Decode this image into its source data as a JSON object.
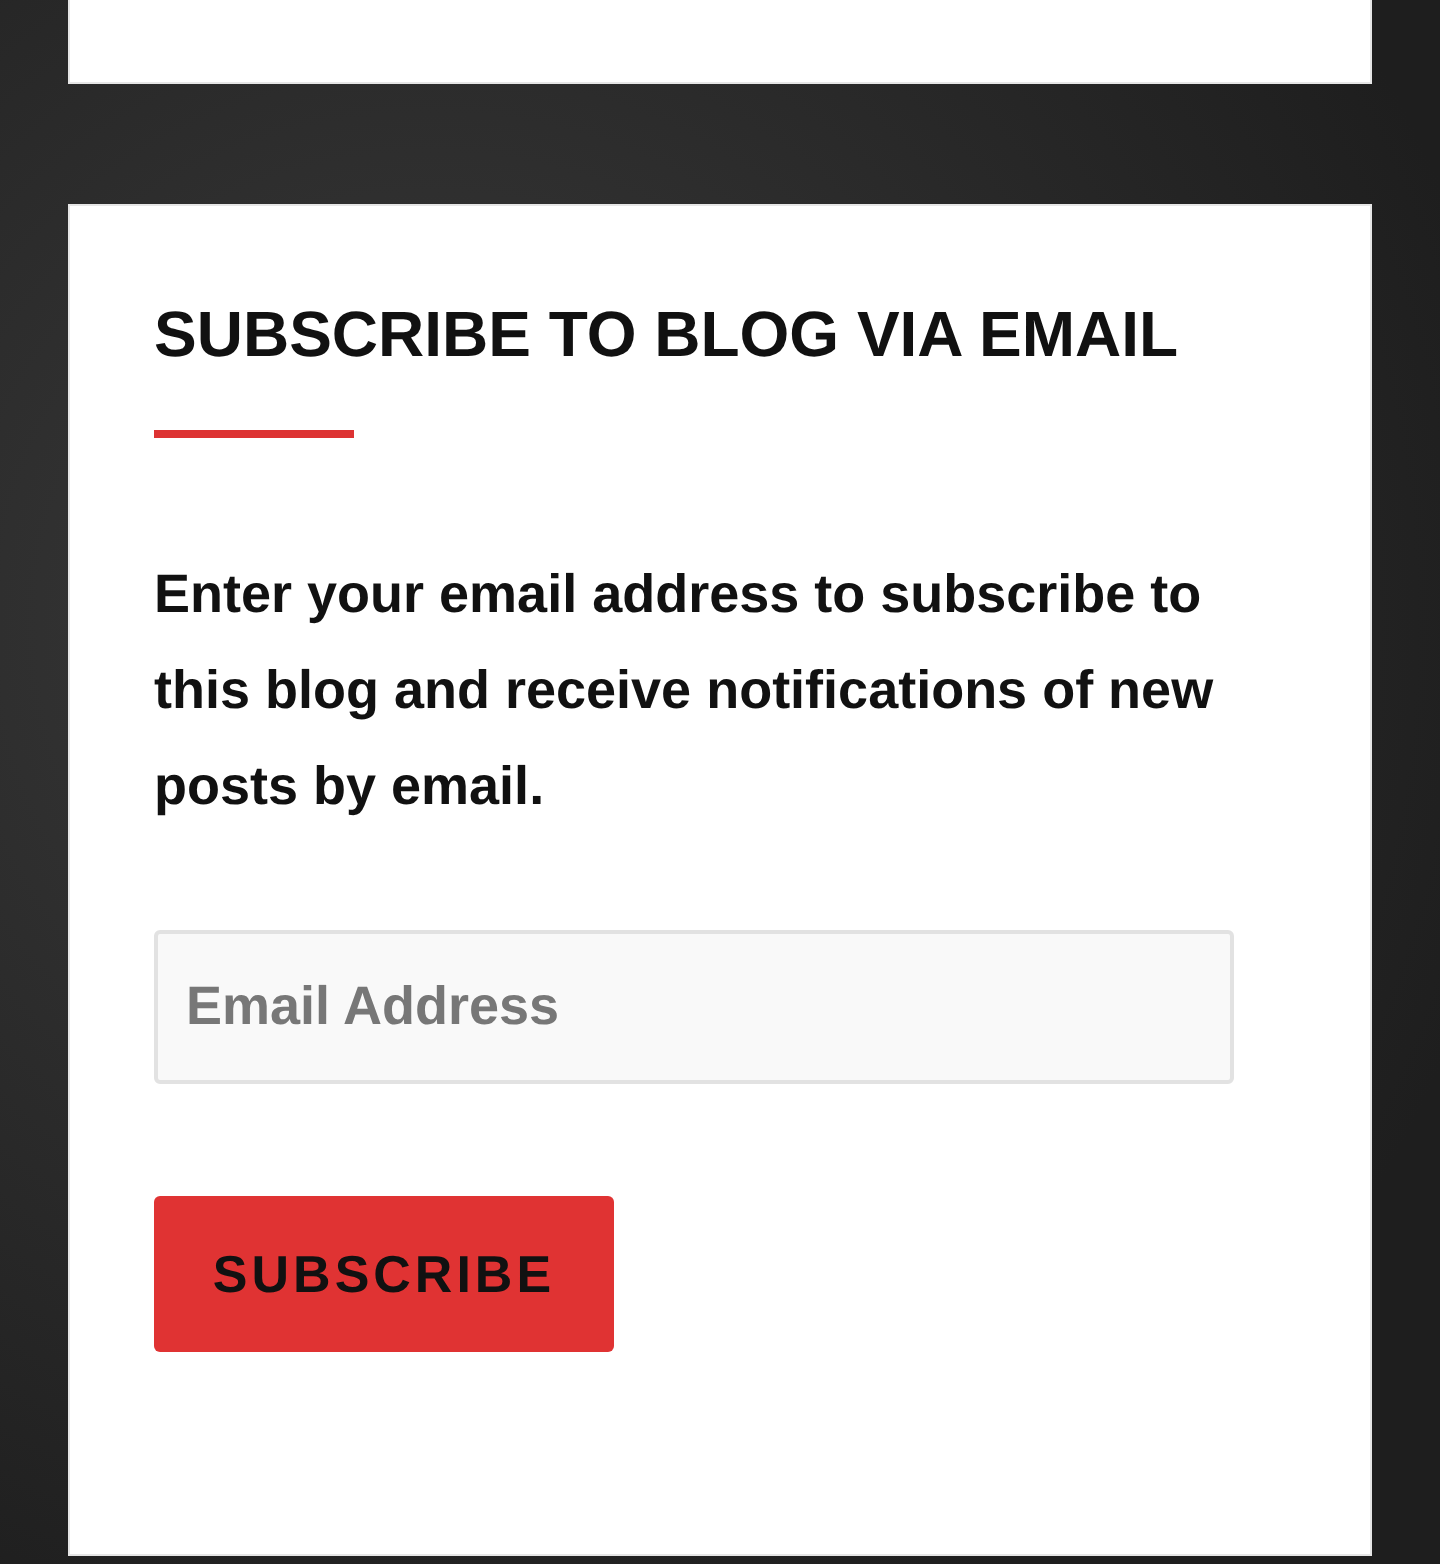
{
  "widget": {
    "title": "SUBSCRIBE TO BLOG VIA EMAIL",
    "description": "Enter your email address to subscribe to this blog and receive notifications of new posts by email.",
    "email_field": {
      "placeholder": "Email Address"
    },
    "button": "SUBSCRIBE"
  }
}
